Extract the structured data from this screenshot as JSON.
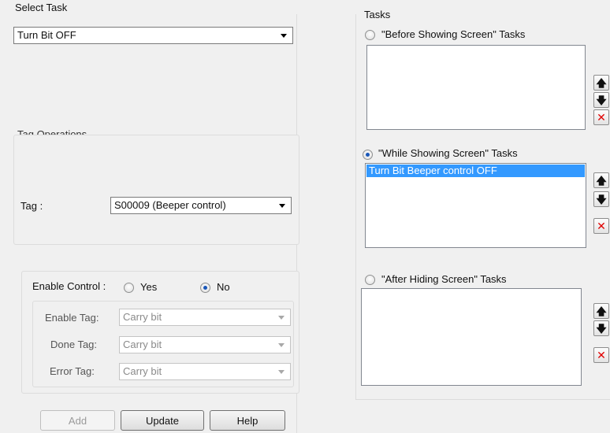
{
  "select_task": {
    "label": "Select Task",
    "value": "Turn Bit OFF"
  },
  "tag_operations": {
    "title": "Tag Operations",
    "tag_label": "Tag :",
    "tag_value": "S00009 (Beeper control)"
  },
  "enable_control": {
    "label": "Enable Control :",
    "yes_label": "Yes",
    "no_label": "No",
    "selected": "No",
    "enable_tag_label": "Enable Tag:",
    "enable_tag_value": "Carry bit",
    "done_tag_label": "Done Tag:",
    "done_tag_value": "Carry bit",
    "error_tag_label": "Error Tag:",
    "error_tag_value": "Carry bit"
  },
  "buttons": {
    "add": "Add",
    "update": "Update",
    "help": "Help"
  },
  "tasks": {
    "title": "Tasks",
    "before": {
      "label": "\"Before Showing Screen\" Tasks",
      "checked": false,
      "items": []
    },
    "while": {
      "label": "\"While Showing Screen\" Tasks",
      "checked": true,
      "items": [
        "Turn Bit Beeper control OFF"
      ]
    },
    "after": {
      "label": "\"After Hiding Screen\" Tasks",
      "checked": false,
      "items": []
    }
  },
  "side_buttons": {
    "up_icon": "arrow-up-icon",
    "down_icon": "arrow-down-icon",
    "delete_icon": "delete-x-icon",
    "up_glyph": "🡅",
    "down_glyph": "🡇",
    "delete_glyph": "✕"
  },
  "colors": {
    "selection": "#3399ff",
    "delete_icon": "#e00000",
    "radio_dot": "#1a57b8"
  }
}
